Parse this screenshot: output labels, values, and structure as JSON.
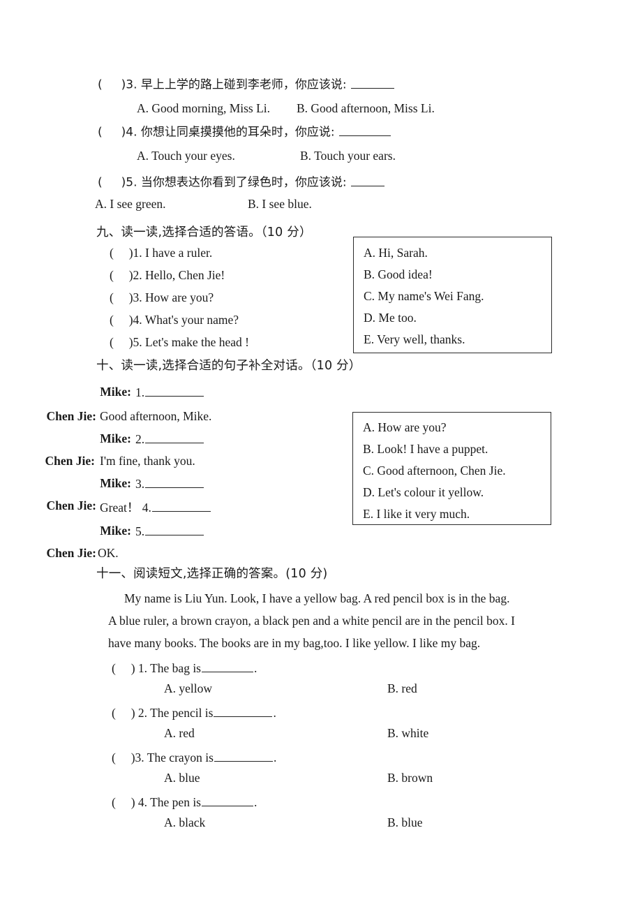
{
  "document": {
    "type": "english-exam-worksheet",
    "language": "zh-CN/en"
  },
  "section_eight_continued": {
    "questions": [
      {
        "bracket": "(",
        "bracket_close": ")3.",
        "prompt": "早上上学的路上碰到李老师，你应该说:",
        "option_a": "A. Good morning, Miss Li.",
        "option_b": "B. Good afternoon, Miss Li."
      },
      {
        "bracket": "(",
        "bracket_close": ")4.",
        "prompt": "你想让同桌摸摸他的耳朵时，你应说:",
        "option_a": "A. Touch your eyes.",
        "option_b": "B. Touch your ears."
      },
      {
        "bracket": "(",
        "bracket_close": ")5.",
        "prompt": "当你想表达你看到了绿色时，你应该说:",
        "option_a": "A. I see green.",
        "option_b": "B. I see blue."
      }
    ]
  },
  "section_nine": {
    "heading": "九、读一读,选择合适的答语。（10 分）",
    "items": [
      {
        "bracket": "(",
        "label": ")1. I have a ruler."
      },
      {
        "bracket": "(",
        "label": ")2. Hello, Chen Jie!"
      },
      {
        "bracket": "(",
        "label": ")3. How are you?"
      },
      {
        "bracket": "(",
        "label": ")4. What's your name?"
      },
      {
        "bracket": "(",
        "label": ")5. Let's make the head !"
      }
    ],
    "answer_box": [
      "A. Hi, Sarah.",
      "B. Good  idea!",
      "C. My name's Wei Fang.",
      "D. Me too.",
      "E. Very well, thanks."
    ]
  },
  "section_ten": {
    "heading": "十、读一读,选择合适的句子补全对话。（10 分）",
    "dialogue": [
      {
        "speaker": "Mike:",
        "text": "1."
      },
      {
        "speaker": "Chen Jie:",
        "text": "Good afternoon, Mike."
      },
      {
        "speaker": "Mike:",
        "text": "2."
      },
      {
        "speaker": "Chen  Jie:",
        "text": "I'm fine, thank you."
      },
      {
        "speaker": "Mike:",
        "text": "3."
      },
      {
        "speaker": "Chen Jie:",
        "text": "Great！ 4."
      },
      {
        "speaker": "Mike:",
        "text": "5."
      },
      {
        "speaker": "Chen Jie:",
        "text": "OK."
      }
    ],
    "answer_box": [
      "A. How are you?",
      "B. Look! I have a puppet.",
      "C. Good afternoon, Chen Jie.",
      "D. Let's colour it yellow.",
      "E. I like it very much."
    ]
  },
  "section_eleven": {
    "heading": "十一、阅读短文,选择正确的答案。(10 分)",
    "passage": [
      "My name is Liu Yun. Look, I have a yellow bag. A red pencil box is in the bag.",
      "A blue ruler, a brown crayon, a black pen and a white pencil are in the pencil box. I",
      "have many books. The books are in my bag,too. I like yellow. I like my bag."
    ],
    "questions": [
      {
        "bracket": "(",
        "number": ") 1. The bag is",
        "tail": ".",
        "option_a": "A. yellow",
        "option_b": "B. red"
      },
      {
        "bracket": "(",
        "number": ") 2. The pencil is",
        "tail": ".",
        "option_a": "A. red",
        "option_b": "B. white"
      },
      {
        "bracket": "(",
        "number": ")3. The crayon is",
        "tail": ".",
        "option_a": "A. blue",
        "option_b": "B. brown"
      },
      {
        "bracket": "(",
        "number": ") 4. The pen is",
        "tail": ".",
        "option_a": "A. black",
        "option_b": "B. blue"
      }
    ]
  }
}
